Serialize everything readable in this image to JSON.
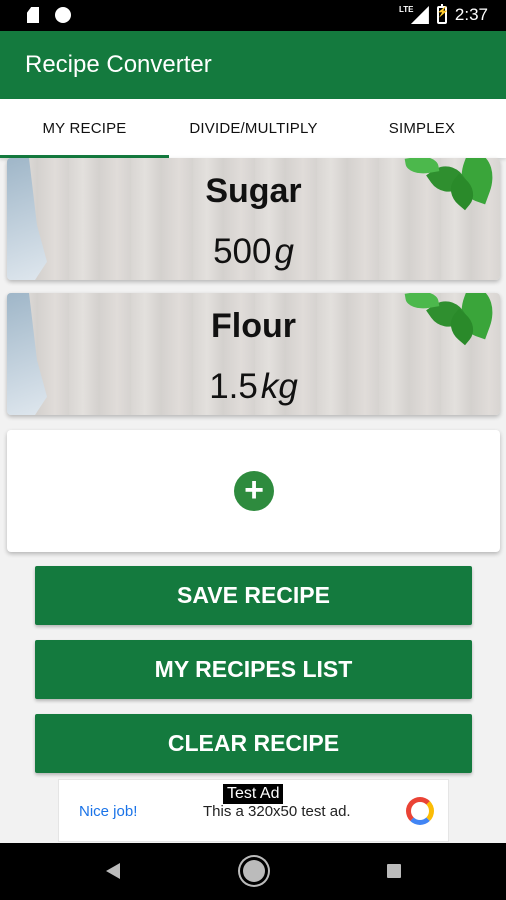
{
  "status_bar": {
    "time": "2:37",
    "network": "LTE",
    "icons": [
      "sd-card-icon",
      "circle-icon",
      "signal-icon",
      "battery-icon"
    ]
  },
  "app_bar": {
    "title": "Recipe Converter"
  },
  "tabs": [
    {
      "label": "MY RECIPE",
      "selected": true
    },
    {
      "label": "DIVIDE/MULTIPLY",
      "selected": false
    },
    {
      "label": "SIMPLEX",
      "selected": false
    }
  ],
  "ingredients": [
    {
      "name": "Sugar",
      "amount": "500",
      "unit": "g"
    },
    {
      "name": "Flour",
      "amount": "1.5",
      "unit": "kg"
    }
  ],
  "add_button": {
    "icon": "plus-icon",
    "symbol": "+"
  },
  "buttons": {
    "save": "SAVE RECIPE",
    "list": "MY RECIPES LIST",
    "clear": "CLEAR RECIPE"
  },
  "ad": {
    "label": "Test Ad",
    "nice": "Nice job!",
    "text": "This a 320x50 test ad."
  },
  "colors": {
    "primary": "#147a3e",
    "accent": "#2e8b3e"
  },
  "nav_bar": {
    "icons": [
      "back-icon",
      "home-icon",
      "recent-apps-icon"
    ]
  }
}
